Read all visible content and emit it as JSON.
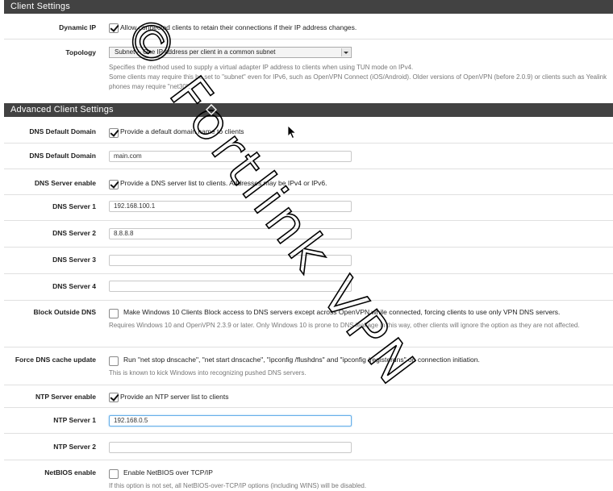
{
  "sections": {
    "client_settings": "Client Settings",
    "advanced_client_settings": "Advanced Client Settings"
  },
  "dynamic_ip": {
    "label": "Dynamic IP",
    "checked": true,
    "text": "Allow connected clients to retain their connections if their IP address changes."
  },
  "topology": {
    "label": "Topology",
    "selected": "Subnet -- One IP address per client in a common subnet",
    "help1": "Specifies the method used to supply a virtual adapter IP address to clients when using TUN mode on IPv4.",
    "help2": "Some clients may require this be set to \"subnet\" even for IPv6, such as OpenVPN Connect (iOS/Android). Older versions of OpenVPN (before 2.0.9) or clients such as Yealink phones may require \"net30\"."
  },
  "dns_default_domain_enable": {
    "label": "DNS Default Domain",
    "checked": true,
    "text": "Provide a default domain name to clients"
  },
  "dns_default_domain": {
    "label": "DNS Default Domain",
    "value": "main.com"
  },
  "dns_server_enable": {
    "label": "DNS Server enable",
    "checked": true,
    "text": "Provide a DNS server list to clients. Addresses may be IPv4 or IPv6."
  },
  "dns_server_1": {
    "label": "DNS Server 1",
    "value": "192.168.100.1"
  },
  "dns_server_2": {
    "label": "DNS Server 2",
    "value": "8.8.8.8"
  },
  "dns_server_3": {
    "label": "DNS Server 3",
    "value": ""
  },
  "dns_server_4": {
    "label": "DNS Server 4",
    "value": ""
  },
  "block_outside_dns": {
    "label": "Block Outside DNS",
    "checked": false,
    "text": "Make Windows 10 Clients Block access to DNS servers except across OpenVPN while connected, forcing clients to use only VPN DNS servers.",
    "help": "Requires Windows 10 and OpenVPN 2.3.9 or later. Only Windows 10 is prone to DNS leakage in this way, other clients will ignore the option as they are not affected."
  },
  "force_dns_cache_update": {
    "label": "Force DNS cache update",
    "checked": false,
    "text": "Run \"net stop dnscache\", \"net start dnscache\", \"ipconfig /flushdns\" and \"ipconfig /registerdns\" on connection initiation.",
    "help": "This is known to kick Windows into recognizing pushed DNS servers."
  },
  "ntp_server_enable": {
    "label": "NTP Server enable",
    "checked": true,
    "text": "Provide an NTP server list to clients"
  },
  "ntp_server_1": {
    "label": "NTP Server 1",
    "value": "192.168.0.5"
  },
  "ntp_server_2": {
    "label": "NTP Server 2",
    "value": ""
  },
  "netbios_enable": {
    "label": "NetBIOS enable",
    "checked": false,
    "text": "Enable NetBIOS over TCP/IP",
    "help": "If this option is not set, all NetBIOS-over-TCP/IP options (including WINS) will be disabled."
  },
  "watermark": "© Fortlink VPN"
}
